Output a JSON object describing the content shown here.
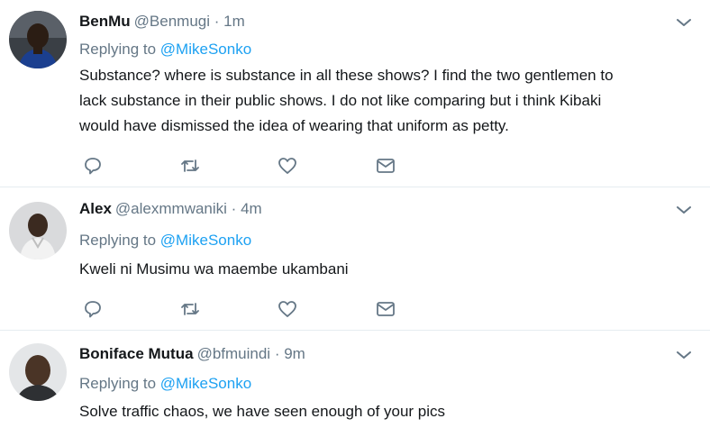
{
  "colors": {
    "accent": "#1da1f2",
    "muted": "#657786",
    "text": "#14171a",
    "divider": "#e6ecf0"
  },
  "replying_label": "Replying to",
  "icons": [
    "reply-icon",
    "retweet-icon",
    "like-icon",
    "message-icon",
    "chevron-down-icon"
  ],
  "tweets": [
    {
      "name": "BenMu",
      "handle": "@Benmugi",
      "separator": "·",
      "time": "1m",
      "reply_to": "@MikeSonko",
      "lines": [
        "Substance? where is substance in all these shows? I find the two gentlemen to",
        "lack substance in their public shows. I do not like comparing but i think Kibaki",
        "would have dismissed the idea of wearing that uniform as petty."
      ]
    },
    {
      "name": "Alex",
      "handle": "@alexmmwaniki",
      "separator": "·",
      "time": "4m",
      "reply_to": "@MikeSonko",
      "lines": [
        "Kweli ni Musimu wa maembe ukambani"
      ]
    },
    {
      "name": "Boniface Mutua",
      "handle": "@bfmuindi",
      "separator": "·",
      "time": "9m",
      "reply_to": "@MikeSonko",
      "lines": [
        "Solve traffic chaos, we have seen enough of your pics"
      ]
    }
  ]
}
